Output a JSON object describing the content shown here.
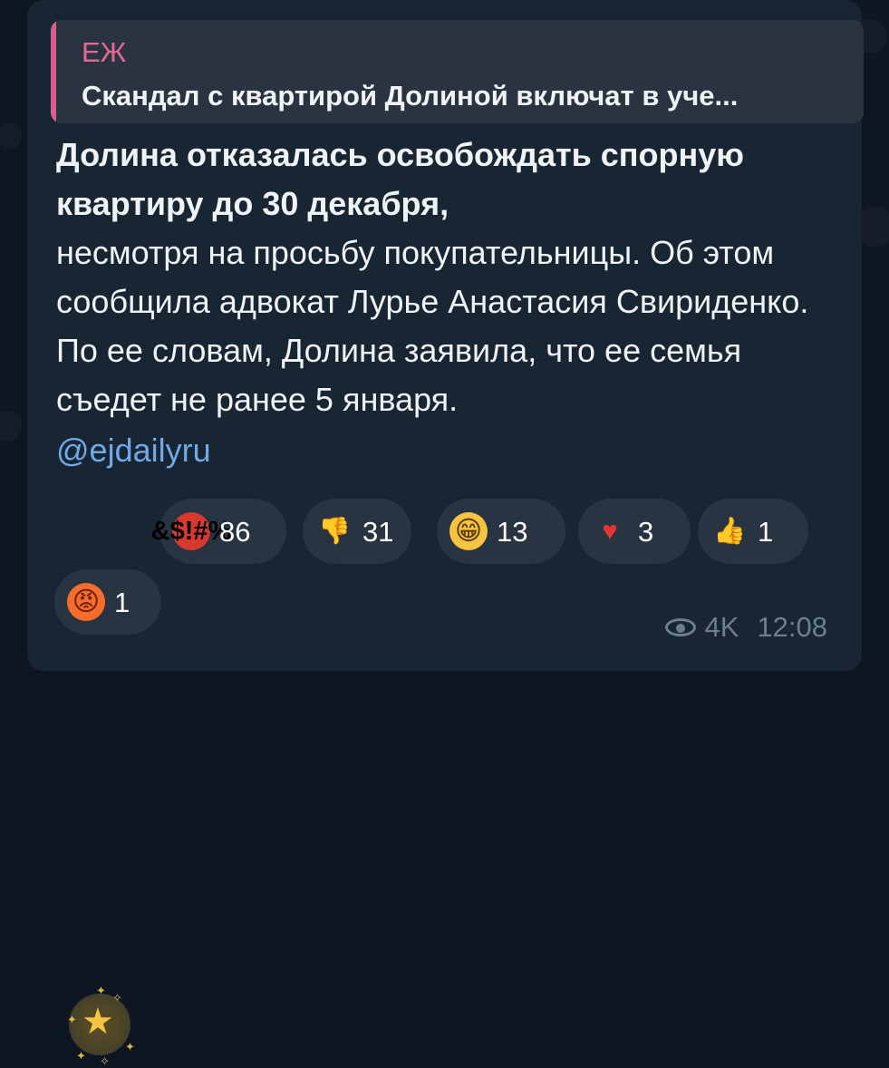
{
  "reply": {
    "author": "ЕЖ",
    "text": "Скандал с квартирой Долиной включат в уче..."
  },
  "message": {
    "bold_text": "Долина отказалась освобождать спорную квартиру до 30 декабря,",
    "text": "несмотря на просьбу покупательницы. Об этом сообщила адвокат Лурье Анастасия Свириденко. По ее словам, Долина заявила, что ее семья съедет не ранее 5 января.",
    "mention": "@ejdailyru"
  },
  "reactions": [
    {
      "name": "star",
      "emoji": "★",
      "count": ""
    },
    {
      "name": "swearing-face",
      "emoji": "&$!#%",
      "count": "86"
    },
    {
      "name": "thumbs-down",
      "emoji": "👎",
      "count": "31"
    },
    {
      "name": "grinning-face",
      "emoji": "😁",
      "count": "13"
    },
    {
      "name": "red-heart",
      "emoji": "♥",
      "count": "3"
    },
    {
      "name": "thumbs-up",
      "emoji": "👍",
      "count": "1"
    },
    {
      "name": "angry-face",
      "emoji": "😡",
      "count": "1"
    }
  ],
  "meta": {
    "views": "4K",
    "time": "12:08"
  },
  "colors": {
    "background": "#0e1621",
    "bubble": "#182533",
    "reply_accent": "#e96893",
    "mention": "#70a9e6",
    "meta": "#6d7f8f"
  }
}
